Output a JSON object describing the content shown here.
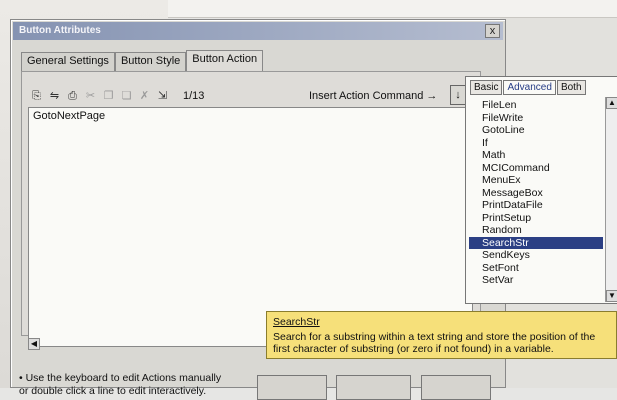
{
  "dialog": {
    "title": "Button Attributes",
    "close_label": "x"
  },
  "tabs": [
    {
      "label": "General Settings"
    },
    {
      "label": "Button Style"
    },
    {
      "label": "Button Action"
    }
  ],
  "toolbar": {
    "counter": "1/13",
    "insert_action_label": "Insert Action Command →",
    "insert_arrow": "↓"
  },
  "editor": {
    "line": "GotoNextPage"
  },
  "popup": {
    "tabs": [
      {
        "label": "Basic"
      },
      {
        "label": "Advanced"
      },
      {
        "label": "Both"
      }
    ],
    "items": [
      "FileLen",
      "FileWrite",
      "GotoLine",
      "If",
      "Math",
      "MCICommand",
      "MenuEx",
      "MessageBox",
      "PrintDataFile",
      "PrintSetup",
      "Random",
      "SearchStr",
      "SendKeys",
      "SetFont",
      "SetVar"
    ],
    "selected": "SearchStr"
  },
  "tooltip": {
    "title": "SearchStr",
    "text": "Search for a substring within a text string and store the position of the first character of substring (or zero if not found) in a variable."
  },
  "hint": {
    "line1": "• Use the keyboard to edit Actions manually",
    "line2": "or double click a line to edit interactively."
  }
}
